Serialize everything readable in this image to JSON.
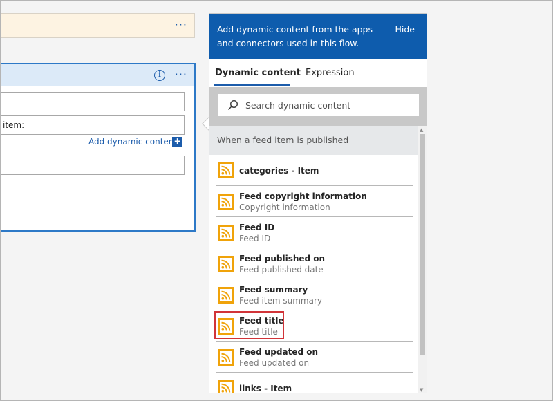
{
  "top_card": {
    "more": "···"
  },
  "action_card": {
    "more": "···",
    "info": "i",
    "field2_text": "item:",
    "add_dynamic_label": "Add dynamic content",
    "add_icon": "+"
  },
  "panel": {
    "header_message": "Add dynamic content from the apps and connectors  used in this flow.",
    "hide_label": "Hide",
    "tabs": [
      {
        "label": "Dynamic content",
        "active": true
      },
      {
        "label": "Expression",
        "active": false
      }
    ],
    "search_placeholder": "Search dynamic content",
    "section_title": "When a feed item is published",
    "items": [
      {
        "title": "categories - Item",
        "subtitle": ""
      },
      {
        "title": "Feed copyright information",
        "subtitle": "Copyright information"
      },
      {
        "title": "Feed ID",
        "subtitle": "Feed ID"
      },
      {
        "title": "Feed published on",
        "subtitle": "Feed published date"
      },
      {
        "title": "Feed summary",
        "subtitle": "Feed item summary"
      },
      {
        "title": "Feed title",
        "subtitle": "Feed title",
        "highlighted": true
      },
      {
        "title": "Feed updated on",
        "subtitle": "Feed updated on"
      },
      {
        "title": "links - Item",
        "subtitle": ""
      }
    ]
  },
  "colors": {
    "accent": "#0e5cad",
    "rss": "#f0a30a",
    "highlight": "#d13438"
  }
}
